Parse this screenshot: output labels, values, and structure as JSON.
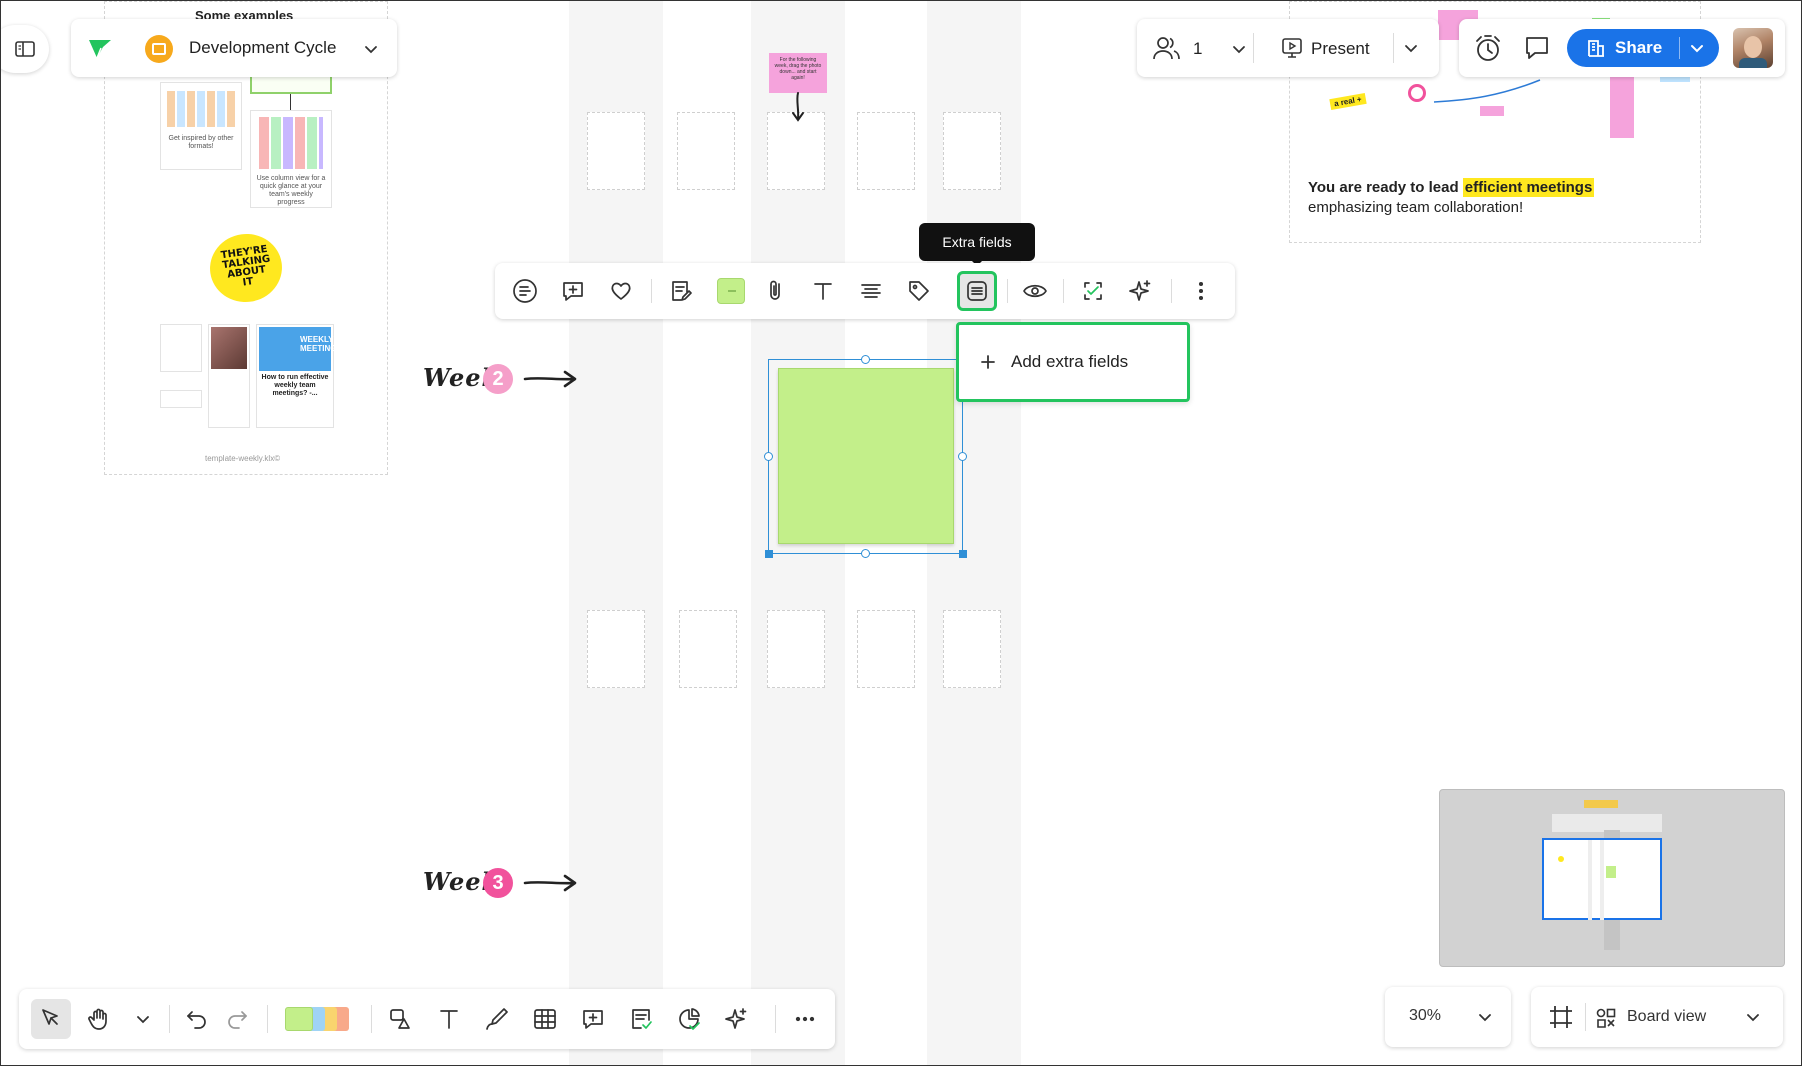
{
  "board": {
    "title": "Development Cycle",
    "examples_title": "Some examples",
    "examples_caption_1": "Get inspired by other formats!",
    "examples_caption_2": "Use column view for a quick glance at your team's weekly progress",
    "talking_badge": "THEY'RE TALKING ABOUT IT",
    "article_title": "How to run effective weekly team meetings? -...",
    "weekly_meeting_tag": "WEEKLY MEETING",
    "template_footer": "template-weekly.klx©",
    "sticky_note_text": "For the following week, drag the photo down... and start again!",
    "week2_label": "Week",
    "week2_number": "2",
    "week3_label": "Week",
    "week3_number": "3",
    "closing_text_prefix": "You are ready to lead ",
    "closing_text_highlight": "efficient meetings",
    "closing_text_line2": "emphasizing team collaboration!",
    "real_tag": "a real +"
  },
  "header": {
    "participants_count": "1",
    "present_label": "Present",
    "share_label": "Share"
  },
  "selection_toolbar": {
    "tooltip": "Extra fields",
    "active_tool": "extra-fields",
    "sticky_color": "#c3ef8a",
    "popup_add_label": "Add extra fields",
    "popup_add_icon": "plus"
  },
  "bottom_right": {
    "zoom": "30%",
    "view_label": "Board view"
  },
  "colors": {
    "accent_green": "#23c45e",
    "share_blue": "#1a73e8",
    "sticky_green": "#c3ef8a",
    "week2_badge": "#f59fc9",
    "week3_badge": "#f1529c",
    "highlight_yellow": "#ffe81f",
    "selection_blue": "#2f8fd6"
  }
}
